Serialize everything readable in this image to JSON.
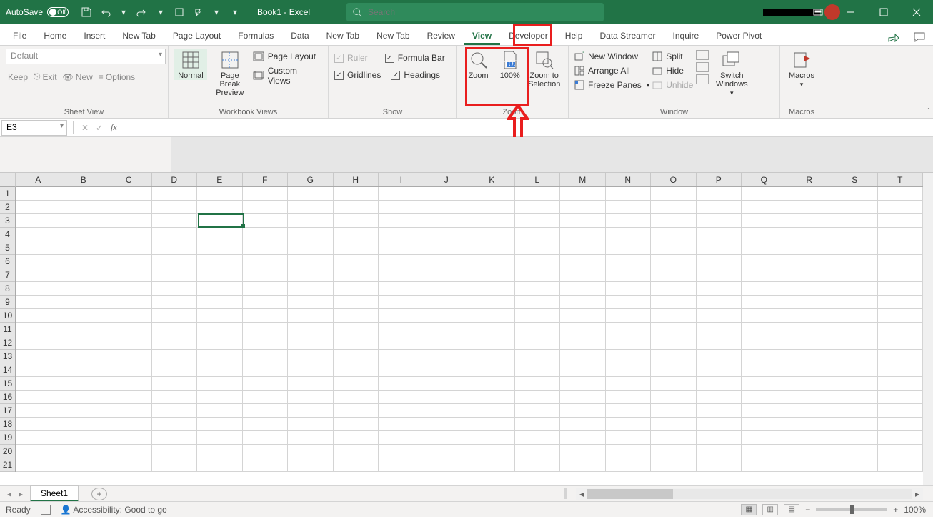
{
  "title_bar": {
    "autosave_label": "AutoSave",
    "autosave_state": "Off",
    "document_title": "Book1  -  Excel",
    "search_placeholder": "Search"
  },
  "window_controls": {
    "ribbon_options": "▾"
  },
  "tabs": [
    "File",
    "Home",
    "Insert",
    "New Tab",
    "Page Layout",
    "Formulas",
    "Data",
    "New Tab",
    "New Tab",
    "Review",
    "View",
    "Developer",
    "Help",
    "Data Streamer",
    "Inquire",
    "Power Pivot"
  ],
  "active_tab": "View",
  "ribbon": {
    "sheet_view": {
      "dropdown": "Default",
      "keep": "Keep",
      "exit": "Exit",
      "new": "New",
      "options": "Options",
      "group_label": "Sheet View"
    },
    "workbook_views": {
      "normal": "Normal",
      "page_break": "Page Break Preview",
      "page_layout": "Page Layout",
      "custom_views": "Custom Views",
      "group_label": "Workbook Views"
    },
    "show": {
      "ruler": "Ruler",
      "formula_bar": "Formula Bar",
      "gridlines": "Gridlines",
      "headings": "Headings",
      "group_label": "Show"
    },
    "zoom": {
      "zoom": "Zoom",
      "hundred": "100%",
      "zoom_to_sel": "Zoom to Selection",
      "group_label": "Zoom"
    },
    "window": {
      "new_window": "New Window",
      "arrange_all": "Arrange All",
      "freeze_panes": "Freeze Panes",
      "split": "Split",
      "hide": "Hide",
      "unhide": "Unhide",
      "switch_windows": "Switch Windows",
      "group_label": "Window"
    },
    "macros": {
      "macros": "Macros",
      "group_label": "Macros"
    }
  },
  "formula_bar": {
    "namebox": "E3",
    "formula": ""
  },
  "grid": {
    "columns": [
      "A",
      "B",
      "C",
      "D",
      "E",
      "F",
      "G",
      "H",
      "I",
      "J",
      "K",
      "L",
      "M",
      "N",
      "O",
      "P",
      "Q",
      "R",
      "S",
      "T"
    ],
    "rows": 21,
    "selected_cell": "E3"
  },
  "sheet_tabs": {
    "active": "Sheet1"
  },
  "status_bar": {
    "ready": "Ready",
    "accessibility": "Accessibility: Good to go",
    "zoom": "100%"
  }
}
